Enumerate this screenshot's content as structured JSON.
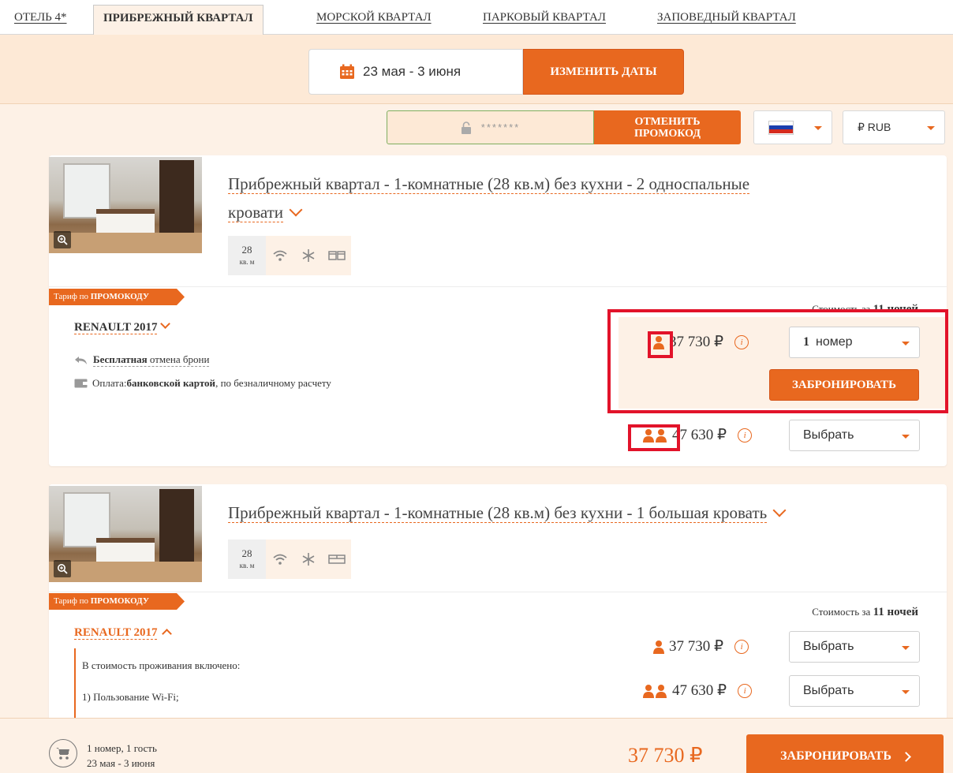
{
  "tabs": [
    {
      "label": "ОТЕЛЬ 4*",
      "active": false
    },
    {
      "label": "ПРИБРЕЖНЫЙ КВАРТАЛ",
      "active": true
    },
    {
      "label": "МОРСКОЙ КВАРТАЛ",
      "active": false
    },
    {
      "label": "ПАРКОВЫЙ КВАРТАЛ",
      "active": false
    },
    {
      "label": "ЗАПОВЕДНЫЙ КВАРТАЛ",
      "active": false
    }
  ],
  "dates": {
    "range": "23 мая - 3 июня",
    "change_label": "ИЗМЕНИТЬ ДАТЫ",
    "icon": "calendar-icon"
  },
  "promo": {
    "masked_value": "*******",
    "cancel_label_line1": "ОТМЕНИТЬ",
    "cancel_label_line2": "ПРОМОКОД"
  },
  "currency": {
    "label": "₽ RUB"
  },
  "rooms": [
    {
      "title_part1": "Прибрежный квартал - 1-комнатные (28 кв.м) без кухни - 2 односпальные",
      "title_part2": "кровати",
      "area_value": "28",
      "area_unit": "кв. м",
      "tariff_badge_prefix": "Тариф по ",
      "tariff_badge_strong": "ПРОМОКОДУ",
      "rate_name": "RENAULT 2017",
      "cost_for_prefix": "Стоимость за ",
      "cost_for_nights": "11 ночей",
      "cancel_note_strong": "Бесплатная",
      "cancel_note_rest": " отмена брони",
      "payment_prefix": "Оплата: ",
      "payment_strong": "банковской картой",
      "payment_rest": ", по безналичному расчету",
      "prices": [
        {
          "guests": 1,
          "amount": "37 730 ₽",
          "select_count": "1",
          "select_label": "номер"
        },
        {
          "guests": 2,
          "amount": "47 630 ₽",
          "select_label": "Выбрать"
        }
      ],
      "book_label": "ЗАБРОНИРОВАТЬ"
    },
    {
      "title_part1": "Прибрежный квартал - 1-комнатные (28 кв.м) без кухни - 1 большая кровать",
      "area_value": "28",
      "area_unit": "кв. м",
      "tariff_badge_prefix": "Тариф по ",
      "tariff_badge_strong": "ПРОМОКОДУ",
      "rate_name": "RENAULT 2017",
      "cost_for_prefix": "Стоимость за ",
      "cost_for_nights": "11 ночей",
      "included_title": "В стоимость проживания включено:",
      "included_item1": "1) Пользование Wi-Fi;",
      "prices": [
        {
          "guests": 1,
          "amount": "37 730 ₽",
          "select_label": "Выбрать"
        },
        {
          "guests": 2,
          "amount": "47 630 ₽",
          "select_label": "Выбрать"
        }
      ]
    }
  ],
  "bottom": {
    "summary_line1": "1 номер, 1 гость",
    "summary_line2": "23 мая - 3 июня",
    "total": "37 730 ₽",
    "book_label": "ЗАБРОНИРОВАТЬ"
  },
  "colors": {
    "accent": "#e8681f",
    "highlight_red": "#e2132a",
    "page_bg": "#fdf1e6"
  }
}
